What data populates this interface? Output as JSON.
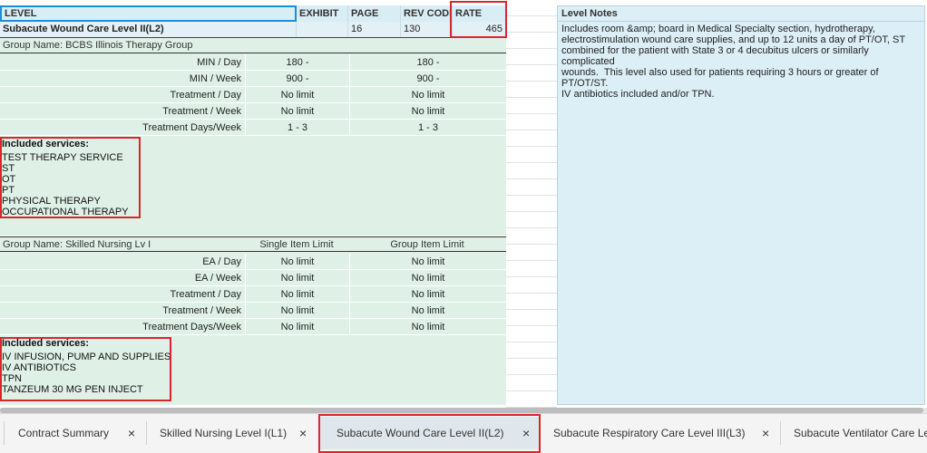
{
  "header": {
    "level": "LEVEL",
    "exhibit": "EXHIBIT",
    "page": "PAGE",
    "rev_code": "REV CODE",
    "rate": "RATE"
  },
  "level_row": {
    "name": "Subacute Wound Care Level II(L2)",
    "exhibit": "",
    "page": "16",
    "rev_code": "130",
    "rate": "465"
  },
  "group1": {
    "title": "Group Name: BCBS Illinois Therapy Group",
    "rows": [
      {
        "label": "MIN / Day",
        "v1": "180 -",
        "v2": "180 -"
      },
      {
        "label": "MIN / Week",
        "v1": "900 -",
        "v2": "900 -"
      },
      {
        "label": "Treatment / Day",
        "v1": "No limit",
        "v2": "No limit"
      },
      {
        "label": "Treatment / Week",
        "v1": "No limit",
        "v2": "No limit"
      },
      {
        "label": "Treatment Days/Week",
        "v1": "1 - 3",
        "v2": "1 - 3"
      }
    ],
    "included_header": "Included services:",
    "included": [
      "TEST THERAPY SERVICE",
      "ST",
      "OT",
      "PT",
      "PHYSICAL THERAPY",
      "OCCUPATIONAL THERAPY"
    ]
  },
  "group2": {
    "title": "Group Name: Skilled Nursing Lv I",
    "col1": "Single Item Limit",
    "col2": "Group Item Limit",
    "rows": [
      {
        "label": "EA / Day",
        "v1": "No limit",
        "v2": "No limit"
      },
      {
        "label": "EA / Week",
        "v1": "No limit",
        "v2": "No limit"
      },
      {
        "label": "Treatment / Day",
        "v1": "No limit",
        "v2": "No limit"
      },
      {
        "label": "Treatment / Week",
        "v1": "No limit",
        "v2": "No limit"
      },
      {
        "label": "Treatment Days/Week",
        "v1": "No limit",
        "v2": "No limit"
      }
    ],
    "included_header": "Included services:",
    "included": [
      "IV INFUSION, PUMP AND SUPPLIES",
      "IV ANTIBIOTICS",
      "TPN",
      "TANZEUM 30 MG PEN INJECT"
    ]
  },
  "notes": {
    "header": "Level Notes",
    "text": "Includes room &amp; board in Medical Specialty section, hydrotherapy,\nelectrostimulation wound care supplies, and up to 12 units a day of PT/OT, ST\ncombined for the patient with State 3 or 4 decubitus ulcers or similarly complicated\nwounds.  This level also used for patients requiring 3 hours or greater of PT/OT/ST.\nIV antibiotics included and/or TPN."
  },
  "tabs": [
    {
      "label": "Contract Summary",
      "close": "×"
    },
    {
      "label": "Skilled Nursing Level I(L1)",
      "close": "×"
    },
    {
      "label": "Subacute Wound Care Level II(L2)",
      "close": "×"
    },
    {
      "label": "Subacute Respiratory Care Level III(L3)",
      "close": "×"
    },
    {
      "label": "Subacute Ventilator Care Le",
      "close": ""
    }
  ],
  "colors": {
    "highlight_box": "#d9262c",
    "green_bg": "#dff1e7",
    "blue_bg": "#dceef6"
  }
}
